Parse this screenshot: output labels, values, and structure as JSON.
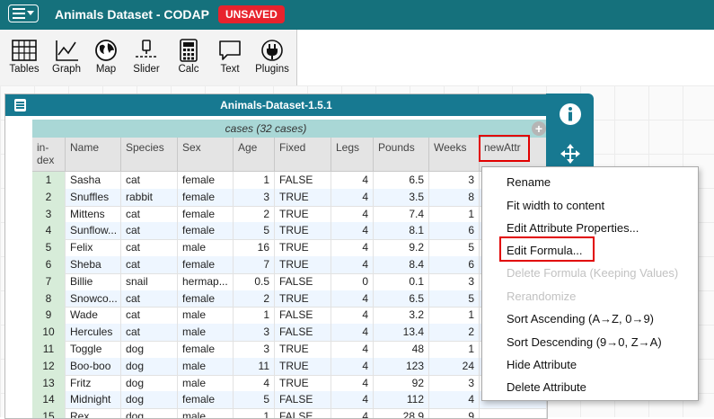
{
  "app": {
    "title": "Animals Dataset - CODAP",
    "unsaved_badge": "UNSAVED"
  },
  "toolbar": {
    "tools": [
      {
        "label": "Tables",
        "icon": "table-icon"
      },
      {
        "label": "Graph",
        "icon": "graph-icon"
      },
      {
        "label": "Map",
        "icon": "map-icon"
      },
      {
        "label": "Slider",
        "icon": "slider-icon"
      },
      {
        "label": "Calc",
        "icon": "calculator-icon"
      },
      {
        "label": "Text",
        "icon": "text-icon"
      },
      {
        "label": "Plugins",
        "icon": "plugins-icon"
      }
    ]
  },
  "table": {
    "title": "Animals-Dataset-1.5.1",
    "cases_title": "cases (32 cases)",
    "add_attribute": "+",
    "columns": [
      "in-dex",
      "Name",
      "Species",
      "Sex",
      "Age",
      "Fixed",
      "Legs",
      "Pounds",
      "Weeks",
      "newAttr"
    ],
    "rows": [
      [
        "1",
        "Sasha",
        "cat",
        "female",
        "1",
        "FALSE",
        "4",
        "6.5",
        "3"
      ],
      [
        "2",
        "Snuffles",
        "rabbit",
        "female",
        "3",
        "TRUE",
        "4",
        "3.5",
        "8"
      ],
      [
        "3",
        "Mittens",
        "cat",
        "female",
        "2",
        "TRUE",
        "4",
        "7.4",
        "1"
      ],
      [
        "4",
        "Sunflow...",
        "cat",
        "female",
        "5",
        "TRUE",
        "4",
        "8.1",
        "6"
      ],
      [
        "5",
        "Felix",
        "cat",
        "male",
        "16",
        "TRUE",
        "4",
        "9.2",
        "5"
      ],
      [
        "6",
        "Sheba",
        "cat",
        "female",
        "7",
        "TRUE",
        "4",
        "8.4",
        "6"
      ],
      [
        "7",
        "Billie",
        "snail",
        "hermap...",
        "0.5",
        "FALSE",
        "0",
        "0.1",
        "3"
      ],
      [
        "8",
        "Snowco...",
        "cat",
        "female",
        "2",
        "TRUE",
        "4",
        "6.5",
        "5"
      ],
      [
        "9",
        "Wade",
        "cat",
        "male",
        "1",
        "FALSE",
        "4",
        "3.2",
        "1"
      ],
      [
        "10",
        "Hercules",
        "cat",
        "male",
        "3",
        "FALSE",
        "4",
        "13.4",
        "2"
      ],
      [
        "11",
        "Toggle",
        "dog",
        "female",
        "3",
        "TRUE",
        "4",
        "48",
        "1"
      ],
      [
        "12",
        "Boo-boo",
        "dog",
        "male",
        "11",
        "TRUE",
        "4",
        "123",
        "24"
      ],
      [
        "13",
        "Fritz",
        "dog",
        "male",
        "4",
        "TRUE",
        "4",
        "92",
        "3"
      ],
      [
        "14",
        "Midnight",
        "dog",
        "female",
        "5",
        "FALSE",
        "4",
        "112",
        "4"
      ],
      [
        "15",
        "Rex",
        "dog",
        "male",
        "1",
        "FALSE",
        "4",
        "28.9",
        "9"
      ]
    ]
  },
  "attribute_menu": {
    "items": [
      {
        "label": "Rename",
        "enabled": true
      },
      {
        "label": "Fit width to content",
        "enabled": true
      },
      {
        "label": "Edit Attribute Properties...",
        "enabled": true
      },
      {
        "label": "Edit Formula...",
        "enabled": true,
        "highlighted": true
      },
      {
        "label": "Delete Formula (Keeping Values)",
        "enabled": false
      },
      {
        "label": "Rerandomize",
        "enabled": false
      },
      {
        "label": "Sort Ascending (A→Z, 0→9)",
        "enabled": true
      },
      {
        "label": "Sort Descending (9→0, Z→A)",
        "enabled": true
      },
      {
        "label": "Hide Attribute",
        "enabled": true
      },
      {
        "label": "Delete Attribute",
        "enabled": true
      }
    ]
  },
  "colors": {
    "title_bar": "#15717c",
    "table_title_bar": "#177991",
    "cases_header": "#a9d7d6",
    "index_column": "#d7ecd9",
    "unsaved_badge": "#e8232d",
    "highlight": "#e10000"
  }
}
